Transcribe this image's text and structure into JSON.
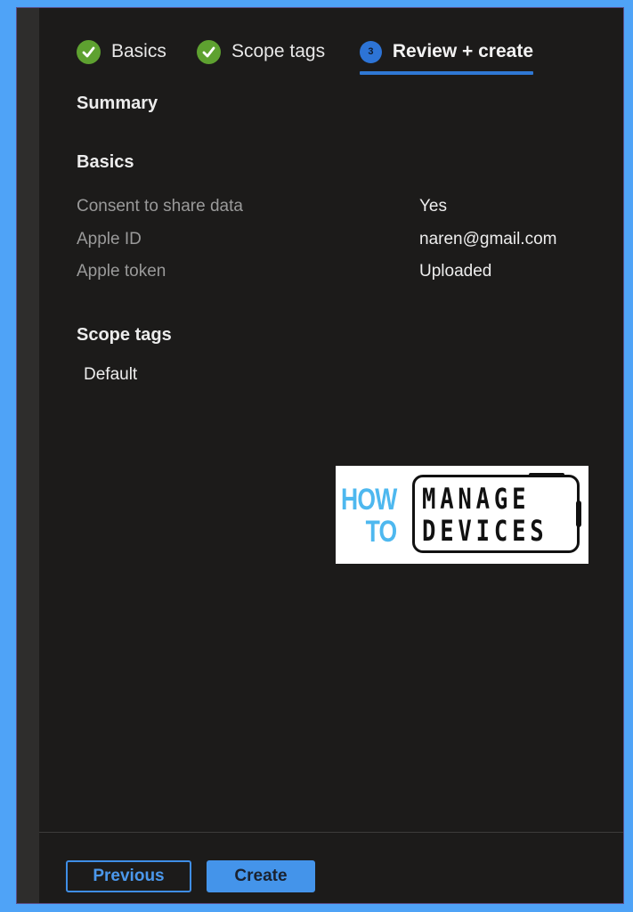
{
  "wizard": {
    "tabs": [
      {
        "label": "Basics",
        "state": "completed",
        "icon": "check-circle-icon"
      },
      {
        "label": "Scope tags",
        "state": "completed",
        "icon": "check-circle-icon"
      },
      {
        "label": "Review + create",
        "state": "active",
        "step_number": "3"
      }
    ]
  },
  "summary": {
    "title": "Summary",
    "basics": {
      "heading": "Basics",
      "rows": [
        {
          "label": "Consent to share data",
          "value": "Yes"
        },
        {
          "label": "Apple ID",
          "value": "naren@gmail.com"
        },
        {
          "label": "Apple token",
          "value": "Uploaded"
        }
      ]
    },
    "scope_tags": {
      "heading": "Scope tags",
      "values": [
        "Default"
      ]
    }
  },
  "watermark": {
    "line1_left": "HOW",
    "line2_left": "TO",
    "line1_right": "MANAGE",
    "line2_right": "DEVICES",
    "accent_color": "#4eb8ef"
  },
  "footer": {
    "previous_label": "Previous",
    "create_label": "Create"
  },
  "colors": {
    "accent": "#2f78d4",
    "success": "#5ea130",
    "background": "#1c1b1a",
    "frame": "#4fa3f7"
  }
}
